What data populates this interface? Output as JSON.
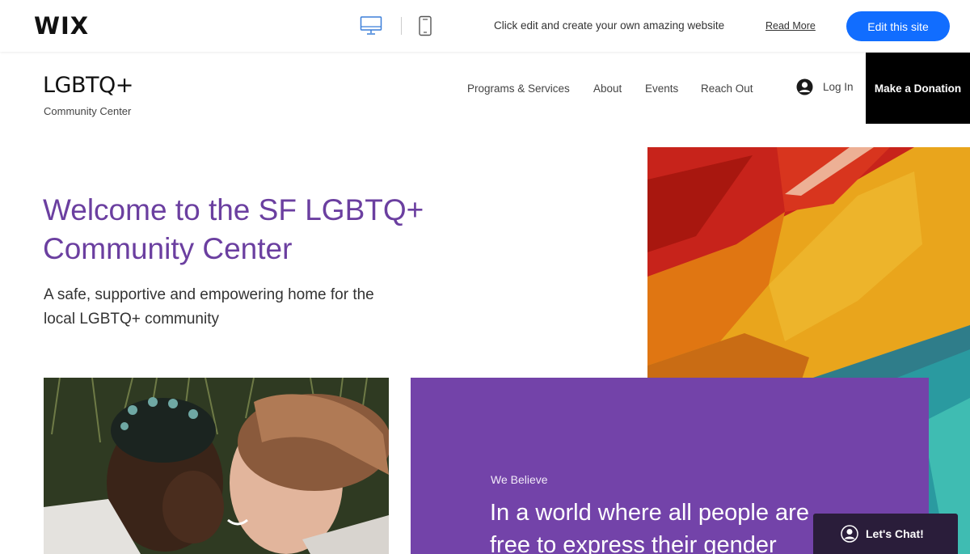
{
  "wix_bar": {
    "logo": "WIX",
    "message": "Click edit and create your own amazing website",
    "read_more": "Read More",
    "edit_button": "Edit this site"
  },
  "site": {
    "logo_title": "LGBTQ+",
    "logo_subtitle": "Community Center",
    "nav": [
      "Programs & Services",
      "About",
      "Events",
      "Reach Out"
    ],
    "login": "Log In",
    "donate": "Make a Donation"
  },
  "hero": {
    "title_line1": "Welcome to the SF LGBTQ+",
    "title_line2": "Community Center",
    "subtitle_line1": "A safe, supportive and empowering home for the",
    "subtitle_line2": "local LGBTQ+ community"
  },
  "believe": {
    "label": "We Believe",
    "line1": "In a world where all people are",
    "line2": "free to express their gender"
  },
  "chat": {
    "label": "Let's Chat!"
  },
  "colors": {
    "brand_purple": "#6b3fa0",
    "panel_purple": "#7343a9",
    "wix_blue": "#116dff",
    "chat_bg": "#2a1d3a"
  }
}
